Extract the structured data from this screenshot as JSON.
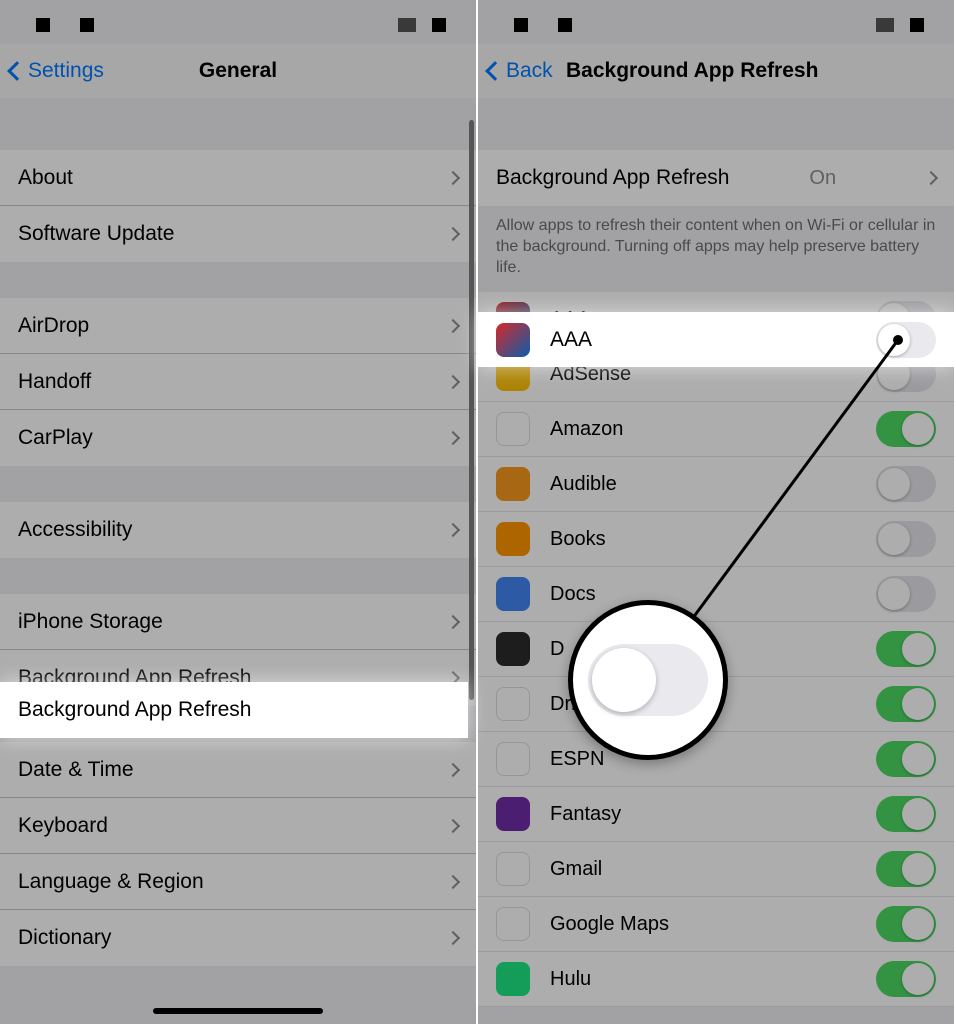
{
  "left": {
    "back_label": "Settings",
    "title": "General",
    "rows": {
      "about": "About",
      "software_update": "Software Update",
      "airdrop": "AirDrop",
      "handoff": "Handoff",
      "carplay": "CarPlay",
      "accessibility": "Accessibility",
      "iphone_storage": "iPhone Storage",
      "bg_refresh": "Background App Refresh",
      "date_time": "Date & Time",
      "keyboard": "Keyboard",
      "lang_region": "Language & Region",
      "dictionary": "Dictionary"
    }
  },
  "right": {
    "back_label": "Back",
    "title": "Background App Refresh",
    "master": {
      "label": "Background App Refresh",
      "value": "On"
    },
    "description": "Allow apps to refresh their content when on Wi-Fi or cellular in the background. Turning off apps may help preserve battery life.",
    "apps": [
      {
        "name": "AAA",
        "icon": "ic-aaa",
        "on": false
      },
      {
        "name": "AdSense",
        "icon": "ic-adsense",
        "on": false
      },
      {
        "name": "Amazon",
        "icon": "ic-amazon",
        "on": true
      },
      {
        "name": "Audible",
        "icon": "ic-audible",
        "on": false
      },
      {
        "name": "Books",
        "icon": "ic-books",
        "on": false
      },
      {
        "name": "Docs",
        "icon": "ic-docs",
        "on": false
      },
      {
        "name": "D",
        "icon": "ic-dk",
        "on": true
      },
      {
        "name": "Drive",
        "icon": "ic-drive",
        "on": true
      },
      {
        "name": "ESPN",
        "icon": "ic-espn",
        "on": true
      },
      {
        "name": "Fantasy",
        "icon": "ic-fantasy",
        "on": true
      },
      {
        "name": "Gmail",
        "icon": "ic-gmail",
        "on": true
      },
      {
        "name": "Google Maps",
        "icon": "ic-gmaps",
        "on": true
      },
      {
        "name": "Hulu",
        "icon": "ic-hulu",
        "on": true
      }
    ]
  }
}
